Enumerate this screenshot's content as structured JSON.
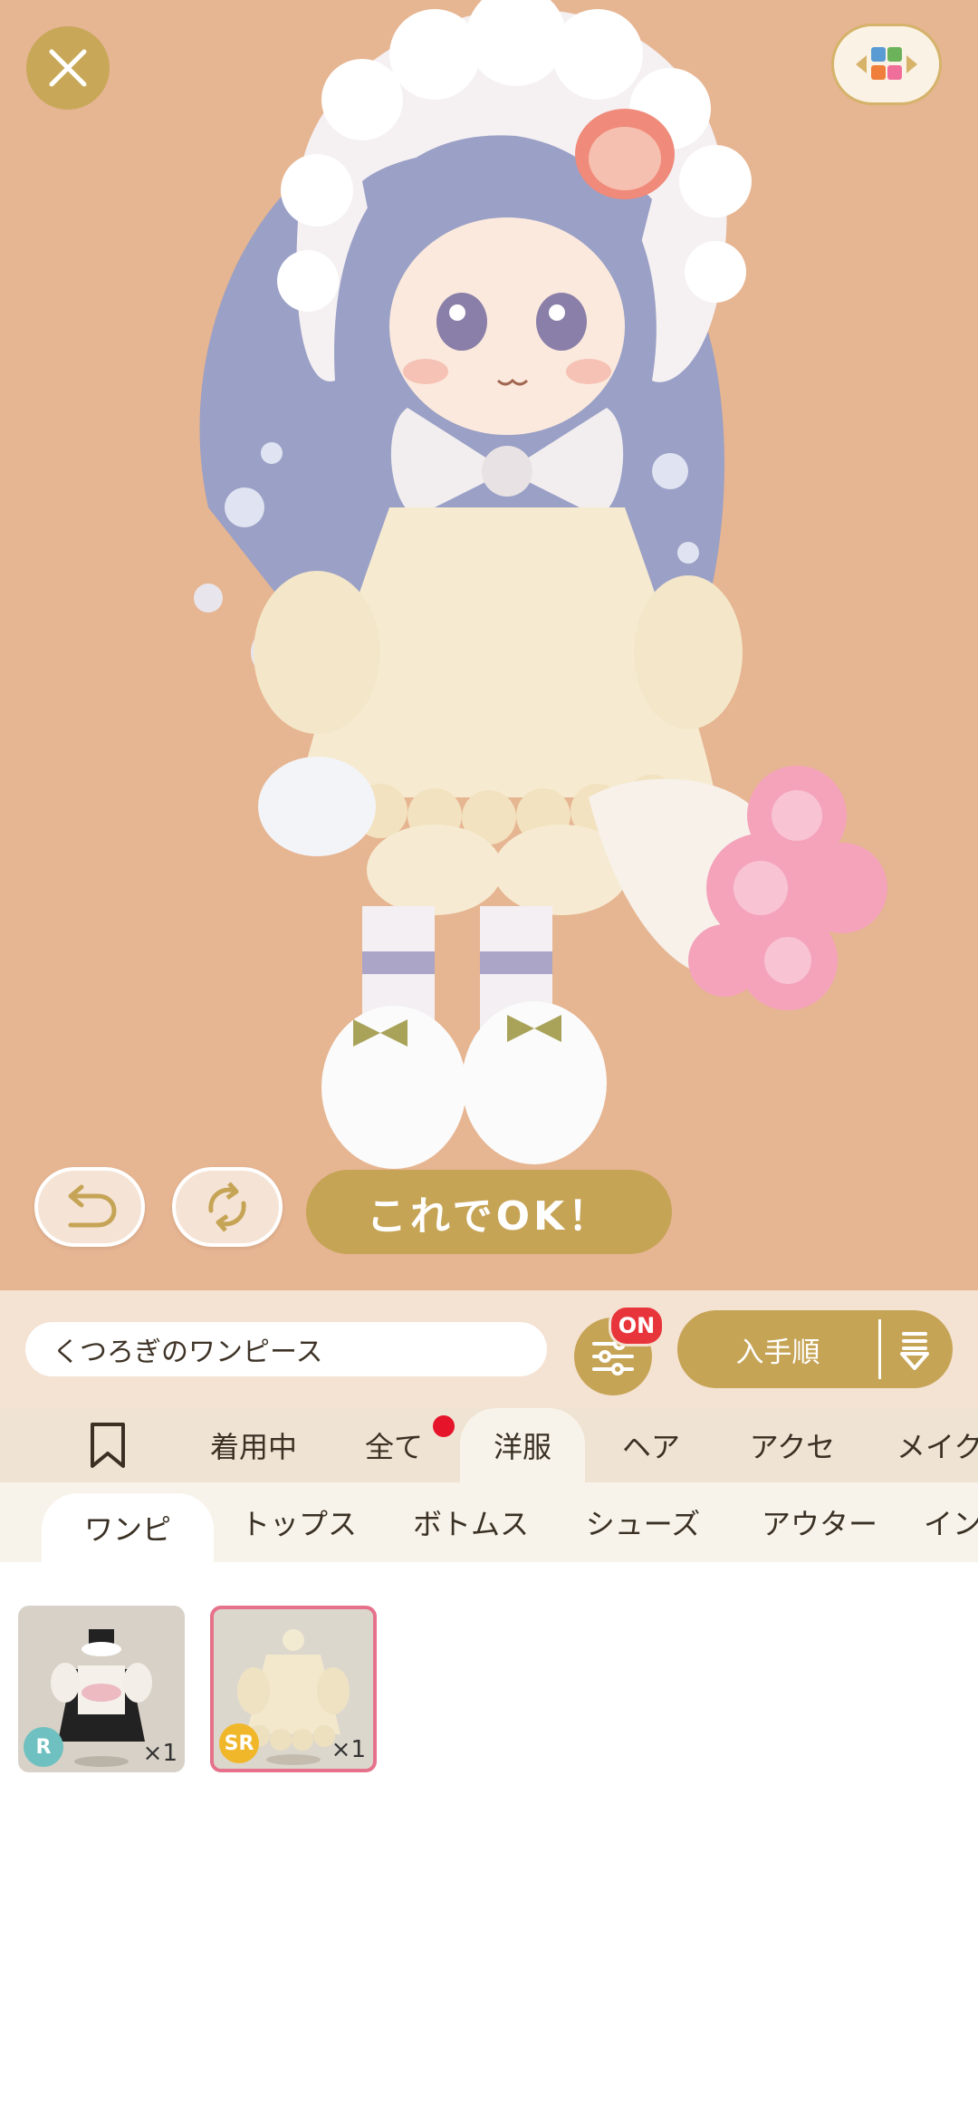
{
  "header": {
    "close_icon": "close-icon",
    "switch_icon": "color-grid-icon"
  },
  "actions": {
    "undo_icon": "undo-icon",
    "refresh_icon": "refresh-icon",
    "ok_label": "これでOK！"
  },
  "search": {
    "value": "くつろぎのワンピース",
    "filter_badge": "ON",
    "sort_label": "入手順"
  },
  "tabs": [
    {
      "label": ""
    },
    {
      "label": "着用中"
    },
    {
      "label": "全て"
    },
    {
      "label": "洋服"
    },
    {
      "label": "ヘア"
    },
    {
      "label": "アクセ"
    },
    {
      "label": "メイク"
    }
  ],
  "subtabs": [
    {
      "label": "ワンピ"
    },
    {
      "label": "トップス"
    },
    {
      "label": "ボトムス"
    },
    {
      "label": "シューズ"
    },
    {
      "label": "アウター"
    },
    {
      "label": "インナー"
    }
  ],
  "items": [
    {
      "rarity": "R",
      "count": "×1",
      "rarity_color": "#6fc0c0"
    },
    {
      "rarity": "SR",
      "count": "×1",
      "rarity_color": "#f0b72a"
    }
  ],
  "colors": {
    "stage_bg": "#e6b592",
    "accent_gold": "#c6a456",
    "badge_red": "#e8353b",
    "selected_border": "#e5728a"
  }
}
